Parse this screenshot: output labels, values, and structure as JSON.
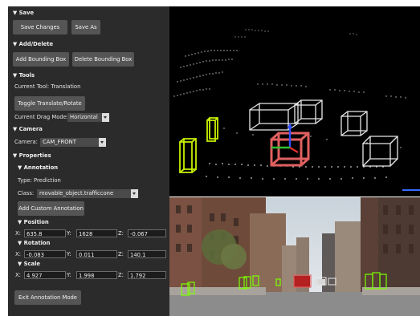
{
  "panel": {
    "save_section": {
      "header": "▼ Save",
      "save_changes": "Save Changes",
      "save_as": "Save As"
    },
    "add_delete_section": {
      "header": "▼ Add/Delete",
      "add_box": "Add Bounding Box",
      "delete_box": "Delete Bounding Box"
    },
    "tools_section": {
      "header": "▼ Tools",
      "current_tool": "Current Tool:  Translation",
      "toggle": "Toggle Translate/Rotate",
      "drag_mode_label": "Current Drag Mode:",
      "drag_mode_value": "Horizontal"
    },
    "camera_section": {
      "header": "▼ Camera",
      "camera_label": "Camera:",
      "camera_value": "CAM_FRONT"
    },
    "properties_section": {
      "header": "▼ Properties",
      "annotation_header": "▼ Annotation",
      "type_text": "Type:   Prediction",
      "class_label": "Class:",
      "class_value": "movable_object.trafficcone",
      "add_custom": "Add Custom Annotation",
      "position_header": "▼ Position",
      "rotation_header": "▼ Rotation",
      "scale_header": "▼ Scale",
      "x_label": "X:",
      "y_label": "Y:",
      "z_label": "Z:",
      "position": {
        "x": "635.8",
        "y": "1628",
        "z": "-0.067"
      },
      "rotation": {
        "x": "-0.083",
        "y": "0.011",
        "z": "140.1"
      },
      "scale": {
        "x": "4.927",
        "y": "1.998",
        "z": "1.792"
      },
      "exit": "Exit Annotation Mode"
    }
  },
  "viewport": {
    "background": "#000000",
    "box_color": "#e8e8e8",
    "selected_box_color": "#e06060",
    "cone_color": "#c8f000",
    "gizmo_colors": {
      "x": "#e03030",
      "y": "#30c030",
      "z": "#3050ff"
    }
  }
}
